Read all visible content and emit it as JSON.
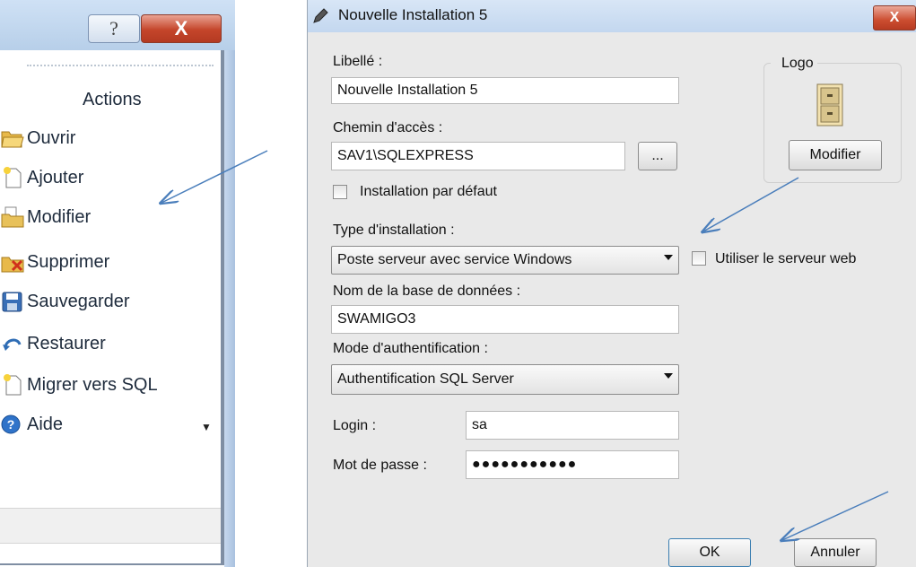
{
  "left_panel": {
    "help_glyph": "?",
    "close_glyph": "X",
    "actions_title": "Actions",
    "items": [
      {
        "label": "Ouvrir",
        "icon": "open-folder-icon"
      },
      {
        "label": "Ajouter",
        "icon": "new-document-icon"
      },
      {
        "label": "Modifier",
        "icon": "edit-folder-icon"
      },
      {
        "label": "Supprimer",
        "icon": "delete-folder-icon"
      },
      {
        "label": "Sauvegarder",
        "icon": "save-icon"
      },
      {
        "label": "Restaurer",
        "icon": "restore-icon"
      },
      {
        "label": "Migrer vers SQL",
        "icon": "new-document-icon"
      },
      {
        "label": "Aide",
        "icon": "help-icon"
      }
    ]
  },
  "dialog": {
    "title": "Nouvelle Installation 5",
    "close_glyph": "X",
    "libelle_label": "Libellé :",
    "libelle_value": "Nouvelle Installation 5",
    "chemin_label": "Chemin d'accès :",
    "chemin_value": "SAV1\\SQLEXPRESS",
    "browse_label": "...",
    "default_install_label": "Installation par défaut",
    "type_label": "Type d'installation :",
    "type_value": "Poste serveur avec service Windows",
    "web_server_label": "Utiliser le serveur web",
    "db_name_label": "Nom de la base de données :",
    "db_name_value": "SWAMIGO3",
    "auth_mode_label": "Mode d'authentification :",
    "auth_mode_value": "Authentification SQL Server",
    "login_label": "Login :",
    "login_value": "sa",
    "password_label": "Mot de passe :",
    "password_value": "●●●●●●●●●●●",
    "logo_caption": "Logo",
    "logo_modify_label": "Modifier",
    "ok_label": "OK",
    "cancel_label": "Annuler"
  },
  "colors": {
    "annotation_arrow": "#4a7ebb",
    "close_button_red": "#c4452a",
    "titlebar_blue": "#c3d7ef"
  }
}
